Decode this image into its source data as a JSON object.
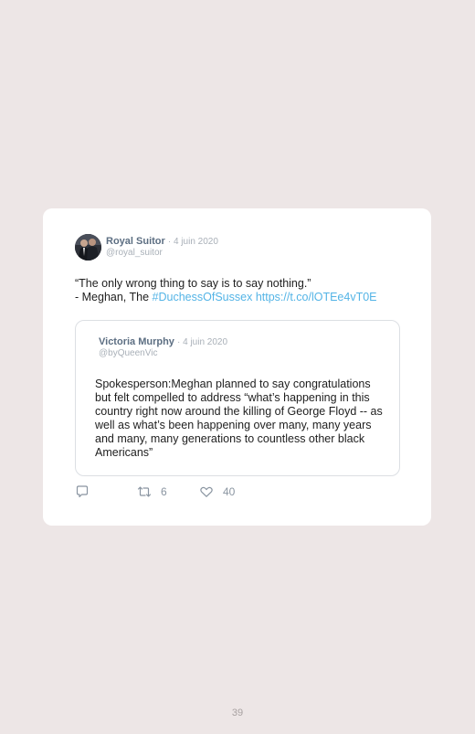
{
  "tweet": {
    "author_name": "Royal Suitor",
    "date": "· 4 juin 2020",
    "handle": "@royal_suitor",
    "text_line1": "“The only wrong thing to say is to say nothing.”",
    "text_line2_prefix": "- Meghan, The ",
    "hashtag": "#DuchessOfSussex",
    "url": "https://t.co/lOTEe4vT0E",
    "link_color": "#54b4e6"
  },
  "quoted_tweet": {
    "author_name": "Victoria Murphy",
    "date": "· 4 juin 2020",
    "handle": "@byQueenVic",
    "text": "Spokesperson:Meghan planned to say congratulations but felt compelled to address “what’s happening in this country right now around the killing of George Floyd -- as well as what’s been happening over many, many years and many, many generations to countless other black Americans”"
  },
  "actions": {
    "reply_icon": "reply-icon",
    "retweet_icon": "retweet-icon",
    "retweet_count": "6",
    "like_icon": "heart-icon",
    "like_count": "40"
  },
  "page": {
    "number": "39",
    "background": "#ede6e6"
  }
}
